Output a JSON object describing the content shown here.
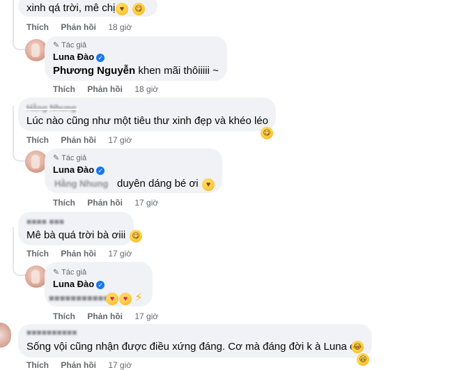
{
  "comments": [
    {
      "id": "c1",
      "text": "xinh qá trời, mê chị",
      "emoji": [
        "smiling-hearts",
        "savoring"
      ],
      "actions": {
        "like": "Thích",
        "reply": "Phản hồi",
        "time": "18 giờ"
      }
    },
    {
      "id": "r1",
      "badge": "Tác giả",
      "author": "Luna Đào",
      "mention": "Phương Nguyễn",
      "text": "khen mãi thôiiiii ~",
      "actions": {
        "like": "Thích",
        "reply": "Phản hồi",
        "time": "18 giờ"
      }
    },
    {
      "id": "c2",
      "author_obscured": "Hằng Nhung",
      "text": "Lúc nào cũng như một tiêu thư xinh đẹp và khéo léo",
      "emoji": [
        "savoring"
      ],
      "actions": {
        "like": "Thích",
        "reply": "Phản hồi",
        "time": "17 giờ"
      }
    },
    {
      "id": "r2",
      "badge": "Tác giả",
      "author": "Luna Đào",
      "mention_obscured": "Hằng Nhung",
      "text": "duyên dáng bé ơi",
      "emoji": [
        "smiling-hearts"
      ],
      "actions": {
        "like": "Thích",
        "reply": "Phản hồi",
        "time": "17 giờ"
      }
    },
    {
      "id": "c3",
      "text": "Mê bà quá trời bà ơiii",
      "emoji": [
        "savoring"
      ],
      "actions": {
        "like": "Thích",
        "reply": "Phản hồi",
        "time": "17 giờ"
      }
    },
    {
      "id": "r3",
      "badge": "Tác giả",
      "author": "Luna Đào",
      "emoji": [
        "heart-eyes",
        "heart-eyes",
        "zap"
      ],
      "actions": {
        "like": "Thích",
        "reply": "Phản hồi",
        "time": "17 giờ"
      }
    },
    {
      "id": "c4",
      "text": "Sống vội cũng nhận được điều xứng đáng. Cơ mà đáng đời k à Luna ơi",
      "emoji": [
        "rofl",
        "laughing"
      ],
      "actions": {
        "like": "Thích",
        "reply": "Phản hồi",
        "time": "17 giờ"
      }
    }
  ],
  "icons": {
    "verified": "verified-badge-icon",
    "author_badge": "pencil-icon"
  },
  "colors": {
    "bubble": "#f0f2f5",
    "meta_text": "#65676b",
    "verified": "#1877f2",
    "thread_line": "#e4e6eb"
  }
}
